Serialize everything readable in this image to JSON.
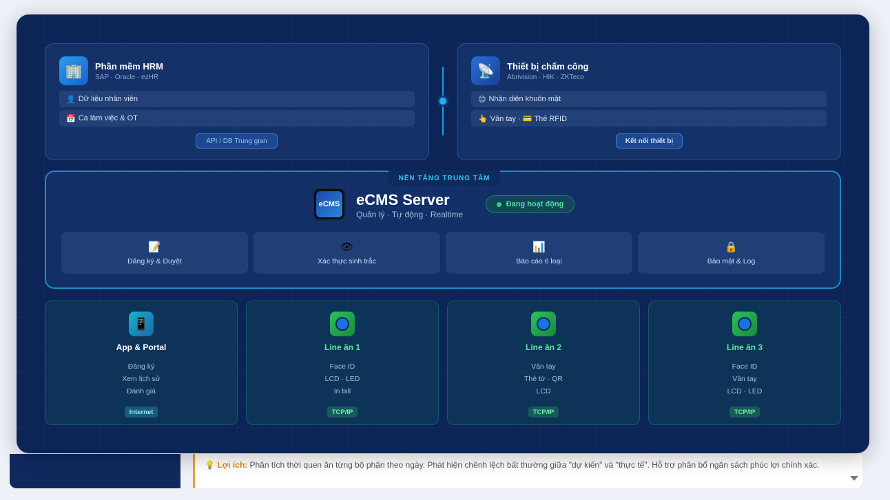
{
  "background": {
    "note_prefix": "💡 Lợi ích:",
    "note_text": "Phân tích thời quen ăn từng bộ phận theo ngày. Phát hiện chênh lệch bất thường giữa \"dự kiến\" và \"thực tế\". Hỗ trợ phân bổ ngân sách phúc lợi chính xác."
  },
  "hrm_card": {
    "icon": "🏢",
    "title": "Phần mềm HRM",
    "subtitle": "SAP · Oracle · ezHR",
    "rows": [
      {
        "icon": "👤",
        "text": "Dữ liệu nhân viên"
      },
      {
        "icon": "📅",
        "text": "Ca làm việc & OT"
      }
    ],
    "button": "API / DB Trung gian"
  },
  "device_card": {
    "icon": "📡",
    "title": "Thiết bị chấm công",
    "subtitle": "Abrivision · HIK · ZKTeco",
    "rows": [
      {
        "icon": "😊",
        "text": "Nhận diện khuôn mặt"
      },
      {
        "icon": "👆",
        "text": "Vân tay · 💳 Thẻ RFID"
      }
    ],
    "button": "Kết nối thiết bị"
  },
  "center": {
    "tag": "NỀN TẢNG TRUNG TÂM",
    "logo_text": "eCMS",
    "title": "eCMS Server",
    "subtitle": "Quản lý · Tự động · Realtime",
    "status": "Đang hoạt động",
    "features": [
      {
        "icon": "📝",
        "label": "Đăng ký & Duyệt"
      },
      {
        "icon": "👁",
        "label": "Xác thực sinh trắc"
      },
      {
        "icon": "📊",
        "label": "Báo cáo 6 loại"
      },
      {
        "icon": "🔒",
        "label": "Bảo mật & Log"
      }
    ]
  },
  "bottom_cards": [
    {
      "title": "App & Portal",
      "items": [
        "Đăng ký",
        "Xem lịch sử",
        "Đánh giá"
      ],
      "badge": "Internet"
    },
    {
      "title": "Line ăn 1",
      "items": [
        "Face ID",
        "LCD · LED",
        "In bill"
      ],
      "badge": "TCP/IP"
    },
    {
      "title": "Line ăn 2",
      "items": [
        "Vân tay",
        "Thẻ từ · QR",
        "LCD"
      ],
      "badge": "TCP/IP"
    },
    {
      "title": "Line ăn 3",
      "items": [
        "Face ID",
        "Vân tay",
        "LCD · LED"
      ],
      "badge": "TCP/IP"
    }
  ],
  "colors": {
    "modal_bg": "#0c2456",
    "accent_cyan": "#1e8cc8",
    "status_green": "#4fe09a",
    "line_green": "#5ee4a0"
  }
}
